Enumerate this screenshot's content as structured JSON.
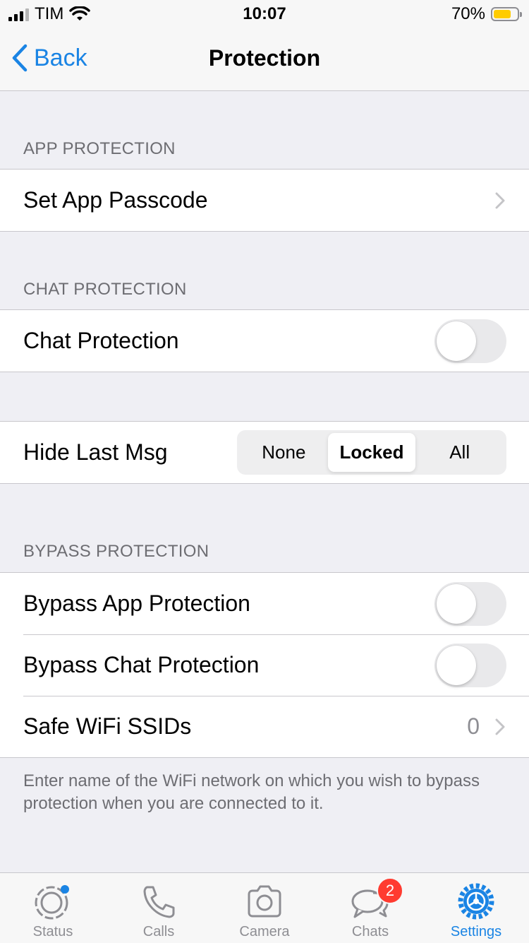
{
  "status_bar": {
    "carrier": "TIM",
    "time": "10:07",
    "battery": "70%",
    "battery_level": 0.7
  },
  "nav": {
    "back_label": "Back",
    "title": "Protection"
  },
  "sections": {
    "app_protection": {
      "header": "APP PROTECTION",
      "passcode_label": "Set App Passcode"
    },
    "chat_protection": {
      "header": "CHAT PROTECTION",
      "toggle_label": "Chat Protection",
      "toggle_on": false
    },
    "hide_last_msg": {
      "label": "Hide Last Msg",
      "options": [
        "None",
        "Locked",
        "All"
      ],
      "selected": "Locked"
    },
    "bypass": {
      "header": "BYPASS PROTECTION",
      "app_label": "Bypass App Protection",
      "app_on": false,
      "chat_label": "Bypass Chat Protection",
      "chat_on": false,
      "ssid_label": "Safe WiFi SSIDs",
      "ssid_count": "0",
      "footer": "Enter name of the WiFi network on which you wish to bypass protection when you are connected to it."
    }
  },
  "tabbar": {
    "tabs": [
      {
        "label": "Status",
        "icon": "status-icon"
      },
      {
        "label": "Calls",
        "icon": "phone-icon"
      },
      {
        "label": "Camera",
        "icon": "camera-icon"
      },
      {
        "label": "Chats",
        "icon": "chats-icon",
        "badge": "2"
      },
      {
        "label": "Settings",
        "icon": "settings-gear-icon",
        "active": true
      }
    ]
  },
  "colors": {
    "accent": "#1a84e4",
    "badge": "#ff3b30",
    "battery_fill": "#ffcc00"
  }
}
